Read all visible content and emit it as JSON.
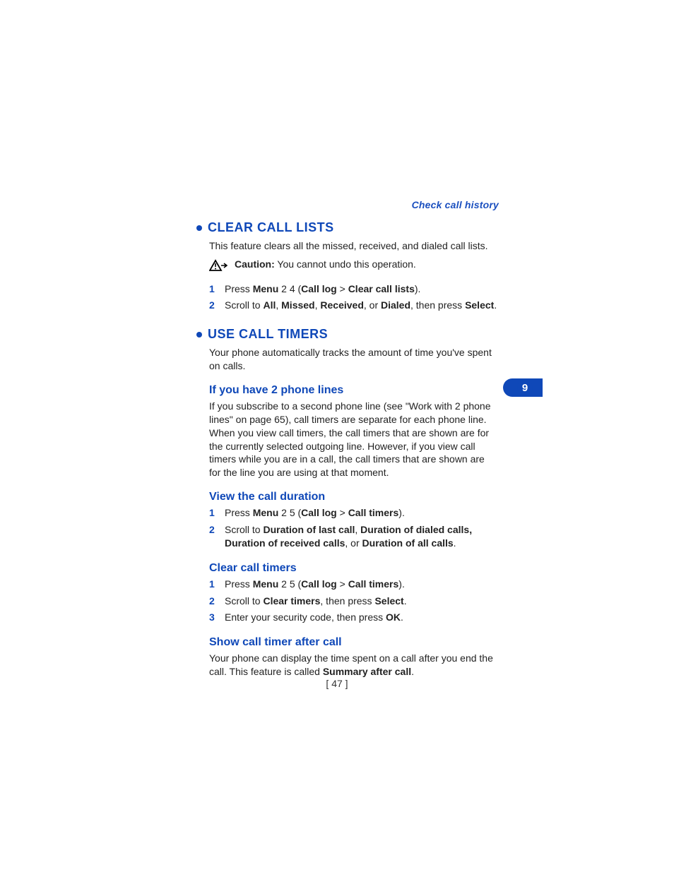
{
  "header": {
    "link": "Check call history"
  },
  "sideTab": {
    "chapter": "9"
  },
  "footer": {
    "page": "[ 47 ]"
  },
  "s1": {
    "title": "CLEAR CALL LISTS",
    "intro": "This feature clears all the missed, received, and dialed call lists.",
    "caution_label": "Caution:",
    "caution_text": " You cannot undo this operation.",
    "step1": {
      "n": "1",
      "a": "Press ",
      "b1": "Menu",
      "c": " 2 4 (",
      "b2": "Call log",
      "d": " > ",
      "b3": "Clear call lists",
      "e": ")."
    },
    "step2": {
      "n": "2",
      "a": "Scroll to ",
      "b1": "All",
      "c": ", ",
      "b2": "Missed",
      "d": ", ",
      "b3": "Received",
      "e": ", or ",
      "b4": "Dialed",
      "f": ", then press ",
      "b5": "Select",
      "g": "."
    }
  },
  "s2": {
    "title": "USE CALL TIMERS",
    "intro": "Your phone automatically tracks the amount of time you've spent on calls.",
    "sub1": {
      "title": "If you have 2 phone lines",
      "body": "If you subscribe to a second phone line (see \"Work with 2 phone lines\" on page 65), call timers are separate for each phone line. When you view call timers, the call timers that are shown are for the currently selected outgoing line. However, if you view call timers while you are in a call, the call timers that are shown are for the line you are using at that moment."
    },
    "sub2": {
      "title": "View the call duration",
      "step1": {
        "n": "1",
        "a": "Press ",
        "b1": "Menu",
        "c": " 2 5 (",
        "b2": "Call log",
        "d": " > ",
        "b3": "Call timers",
        "e": ")."
      },
      "step2": {
        "n": "2",
        "a": "Scroll to ",
        "b1": "Duration of last call",
        "c": ", ",
        "b2": "Duration of dialed calls, Duration of received calls",
        "d": ", or ",
        "b3": "Duration of all calls",
        "e": "."
      }
    },
    "sub3": {
      "title": "Clear call timers",
      "step1": {
        "n": "1",
        "a": "Press ",
        "b1": "Menu",
        "c": " 2 5 (",
        "b2": "Call log",
        "d": " > ",
        "b3": "Call timers",
        "e": ")."
      },
      "step2": {
        "n": "2",
        "a": "Scroll to ",
        "b1": "Clear timers",
        "c": ", then press ",
        "b2": "Select",
        "d": "."
      },
      "step3": {
        "n": "3",
        "a": "Enter your security code, then press ",
        "b1": "OK",
        "c": "."
      }
    },
    "sub4": {
      "title": "Show call timer after call",
      "body_a": "Your phone can display the time spent on a call after you end the call. This feature is called ",
      "body_b": "Summary after call",
      "body_c": "."
    }
  }
}
